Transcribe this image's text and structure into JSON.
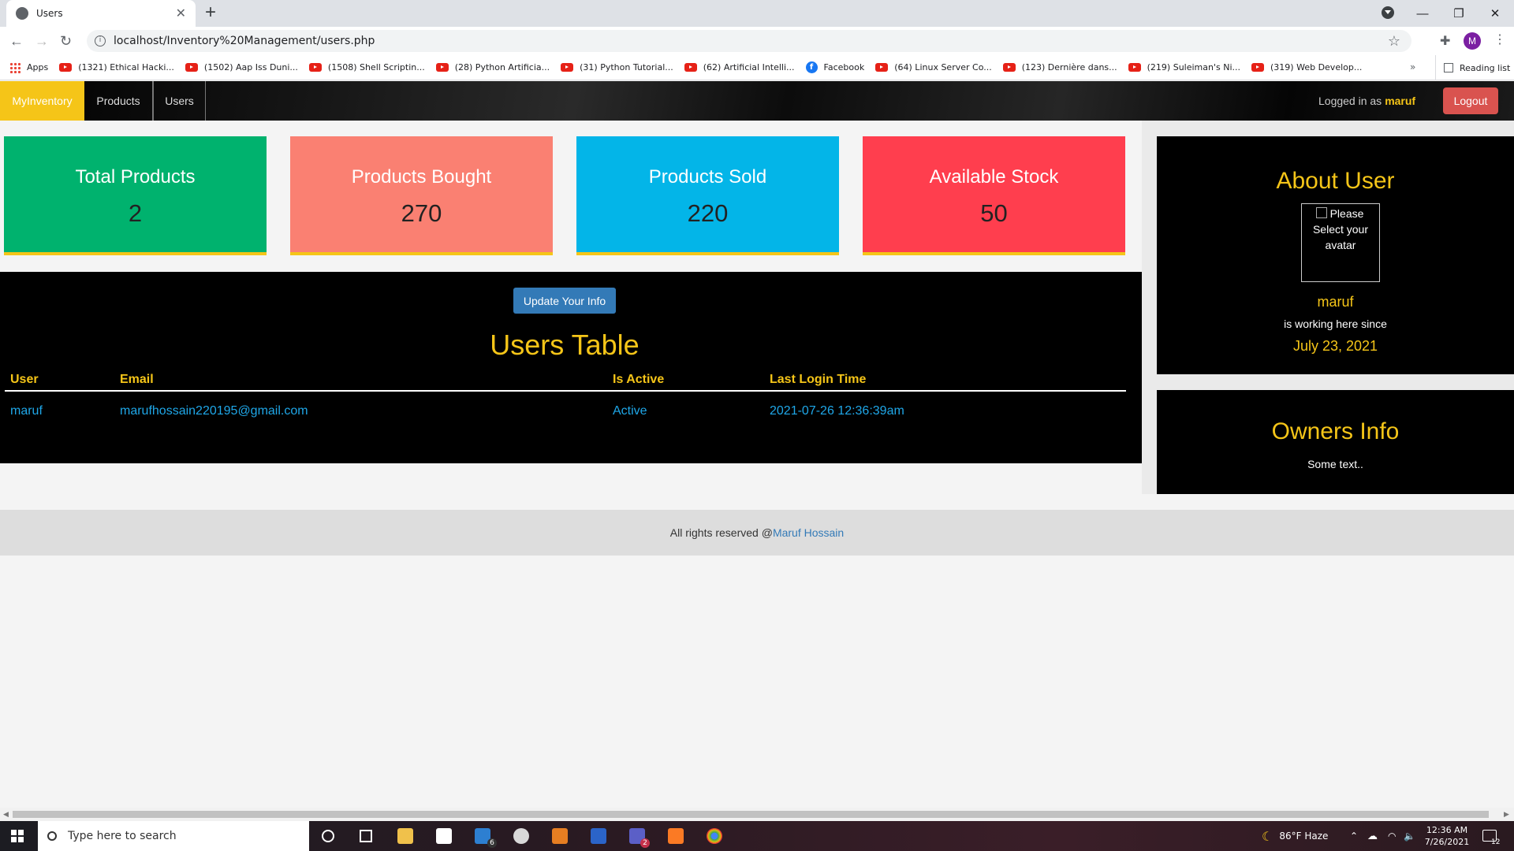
{
  "browser": {
    "tab_title": "Users",
    "url": "localhost/Inventory%20Management/users.php",
    "profile_initial": "M",
    "bookmarks": [
      "Apps",
      "(1321) Ethical Hacki...",
      "(1502) Aap Iss Duni...",
      "(1508) Shell Scriptin...",
      "(28) Python Artificia...",
      "(31) Python Tutorial...",
      "(62) Artificial Intelli...",
      "Facebook",
      "(64) Linux Server Co...",
      "(123) Dernière dans...",
      "(219) Suleiman's Ni...",
      "(319) Web Develop..."
    ],
    "more": "»",
    "reading_list": "Reading list"
  },
  "nav": {
    "brand": "MyInventory",
    "links": [
      "Products",
      "Users"
    ],
    "logged_in_prefix": "Logged in as",
    "username": "maruf",
    "logout": "Logout"
  },
  "cards": [
    {
      "label": "Total Products",
      "value": "2",
      "color": "#00b26e"
    },
    {
      "label": "Products Bought",
      "value": "270",
      "color": "#fa8072"
    },
    {
      "label": "Products Sold",
      "value": "220",
      "color": "#03b5e8"
    },
    {
      "label": "Available Stock",
      "value": "50",
      "color": "#ff3e4e"
    }
  ],
  "users": {
    "update_button": "Update Your Info",
    "title": "Users Table",
    "columns": [
      "User",
      "Email",
      "Is Active",
      "Last Login Time"
    ],
    "rows": [
      [
        "maruf",
        "marufhossain220195@gmail.com",
        "Active",
        "2021-07-26 12:36:39am"
      ]
    ]
  },
  "about": {
    "title": "About User",
    "avatar_alt": "Please Select your avatar",
    "name": "maruf",
    "since_text": "is working here since",
    "date": "July 23, 2021"
  },
  "owners": {
    "title": "Owners Info",
    "text": "Some text.."
  },
  "footer": {
    "text": "All rights reserved @",
    "link": "Maruf Hossain"
  },
  "taskbar": {
    "search_placeholder": "Type here to search",
    "mail_badge": "6",
    "teams_badge": "2",
    "weather": "86°F  Haze",
    "time": "12:36 AM",
    "date": "7/26/2021",
    "notif_count": "12"
  },
  "colors": {
    "accent_yellow": "#f5c518",
    "link_blue": "#1fa7e8",
    "logout_red": "#d9534f",
    "update_blue": "#337ab7"
  }
}
